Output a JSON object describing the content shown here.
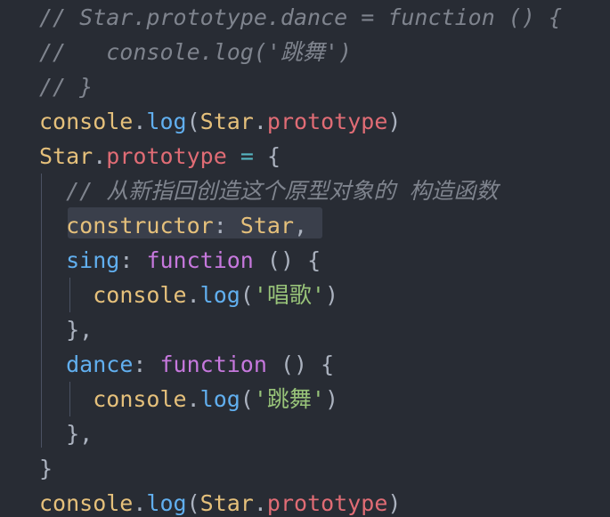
{
  "editor": {
    "colors": {
      "background": "#282c34",
      "comment": "#7f848e",
      "identifier": "#e5c07b",
      "property": "#e06c75",
      "function": "#61afef",
      "keyword": "#c678dd",
      "operator": "#56b6c2",
      "string": "#98c379",
      "punctuation": "#abb2bf",
      "indent_guide": "#4b5263"
    },
    "lines": [
      [
        {
          "t": "// Star.prototype.dance = function () {",
          "c": "comment"
        }
      ],
      [
        {
          "t": "//   console.log('跳舞')",
          "c": "comment"
        }
      ],
      [
        {
          "t": "// }",
          "c": "comment"
        }
      ],
      [
        {
          "t": "console",
          "c": "ident"
        },
        {
          "t": ".",
          "c": "punc"
        },
        {
          "t": "log",
          "c": "func"
        },
        {
          "t": "(",
          "c": "punc"
        },
        {
          "t": "Star",
          "c": "ident"
        },
        {
          "t": ".",
          "c": "punc"
        },
        {
          "t": "prototype",
          "c": "prop"
        },
        {
          "t": ")",
          "c": "punc"
        }
      ],
      [
        {
          "t": "Star",
          "c": "ident"
        },
        {
          "t": ".",
          "c": "punc"
        },
        {
          "t": "prototype",
          "c": "prop"
        },
        {
          "t": " ",
          "c": "text"
        },
        {
          "t": "=",
          "c": "op"
        },
        {
          "t": " ",
          "c": "text"
        },
        {
          "t": "{",
          "c": "brace"
        }
      ],
      [
        {
          "t": "  ",
          "c": "text"
        },
        {
          "t": "// 从新指回创造这个原型对象的 构造函数",
          "c": "comment"
        }
      ],
      [
        {
          "t": "  ",
          "c": "text"
        },
        {
          "t": "constructor",
          "c": "ident"
        },
        {
          "t": ": ",
          "c": "punc"
        },
        {
          "t": "Star",
          "c": "ident"
        },
        {
          "t": ",",
          "c": "punc"
        }
      ],
      [
        {
          "t": "  ",
          "c": "text"
        },
        {
          "t": "sing",
          "c": "func"
        },
        {
          "t": ": ",
          "c": "punc"
        },
        {
          "t": "function",
          "c": "keyword"
        },
        {
          "t": " () {",
          "c": "punc"
        }
      ],
      [
        {
          "t": "    ",
          "c": "text"
        },
        {
          "t": "console",
          "c": "ident"
        },
        {
          "t": ".",
          "c": "punc"
        },
        {
          "t": "log",
          "c": "func"
        },
        {
          "t": "(",
          "c": "punc"
        },
        {
          "t": "'唱歌'",
          "c": "string"
        },
        {
          "t": ")",
          "c": "punc"
        }
      ],
      [
        {
          "t": "  ",
          "c": "text"
        },
        {
          "t": "},",
          "c": "punc"
        }
      ],
      [
        {
          "t": "  ",
          "c": "text"
        },
        {
          "t": "dance",
          "c": "func"
        },
        {
          "t": ": ",
          "c": "punc"
        },
        {
          "t": "function",
          "c": "keyword"
        },
        {
          "t": " () {",
          "c": "punc"
        }
      ],
      [
        {
          "t": "    ",
          "c": "text"
        },
        {
          "t": "console",
          "c": "ident"
        },
        {
          "t": ".",
          "c": "punc"
        },
        {
          "t": "log",
          "c": "func"
        },
        {
          "t": "(",
          "c": "punc"
        },
        {
          "t": "'跳舞'",
          "c": "string"
        },
        {
          "t": ")",
          "c": "punc"
        }
      ],
      [
        {
          "t": "  ",
          "c": "text"
        },
        {
          "t": "},",
          "c": "punc"
        }
      ],
      [
        {
          "t": "}",
          "c": "brace"
        }
      ],
      [
        {
          "t": "console",
          "c": "ident"
        },
        {
          "t": ".",
          "c": "punc"
        },
        {
          "t": "log",
          "c": "func"
        },
        {
          "t": "(",
          "c": "punc"
        },
        {
          "t": "Star",
          "c": "ident"
        },
        {
          "t": ".",
          "c": "punc"
        },
        {
          "t": "prototype",
          "c": "prop"
        },
        {
          "t": ")",
          "c": "punc"
        }
      ]
    ]
  }
}
